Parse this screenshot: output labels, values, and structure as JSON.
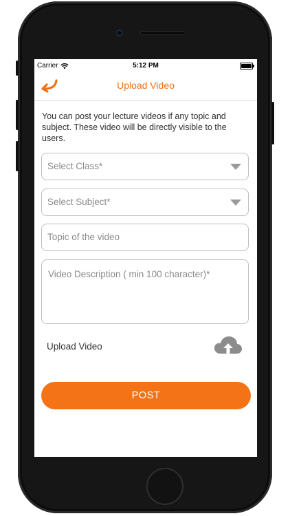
{
  "status_bar": {
    "carrier": "Carrier",
    "time": "5:12 PM"
  },
  "nav": {
    "title": "Upload Video",
    "back_icon": "back-arrow-icon"
  },
  "intro_text": "You can post your lecture videos if any topic and subject. These video will be directly visible to the users.",
  "form": {
    "select_class": {
      "placeholder": "Select Class*"
    },
    "select_subject": {
      "placeholder": "Select Subject*"
    },
    "topic": {
      "placeholder": "Topic of the video"
    },
    "description": {
      "placeholder": "Video Description ( min 100 character)*"
    },
    "upload_label": "Upload Video",
    "upload_icon": "cloud-upload-icon"
  },
  "post_button_label": "POST",
  "colors": {
    "accent": "#f47316",
    "title": "#f07014",
    "border": "#bdbdbd",
    "icon_gray": "#9a9a9a"
  }
}
